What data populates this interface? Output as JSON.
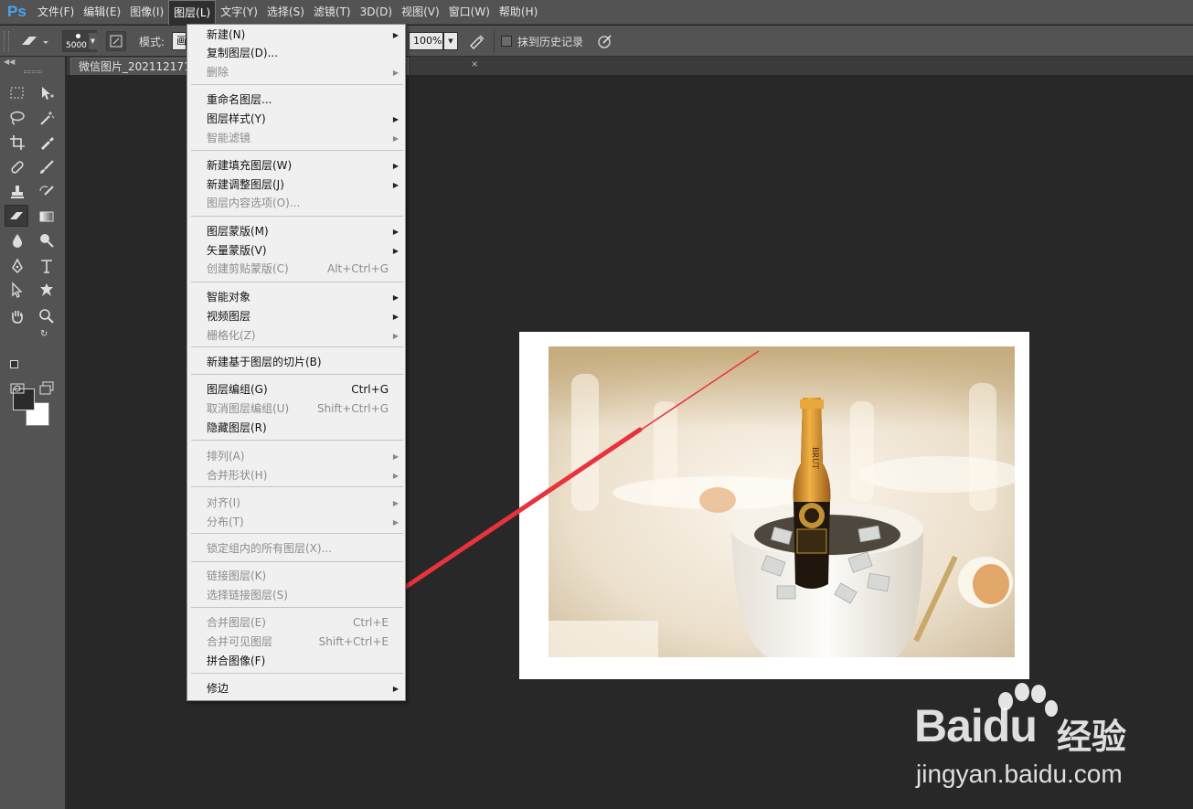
{
  "app": {
    "logo": "Ps"
  },
  "menubar": [
    {
      "label": "文件(F)"
    },
    {
      "label": "编辑(E)"
    },
    {
      "label": "图像(I)"
    },
    {
      "label": "图层(L)",
      "active": true
    },
    {
      "label": "文字(Y)"
    },
    {
      "label": "选择(S)"
    },
    {
      "label": "滤镜(T)"
    },
    {
      "label": "3D(D)"
    },
    {
      "label": "视图(V)"
    },
    {
      "label": "窗口(W)"
    },
    {
      "label": "帮助(H)"
    }
  ],
  "options": {
    "brush_size": "5000",
    "mode_label": "模式:",
    "mode_value": "画",
    "flow_value": "100%",
    "history_label": "抹到历史记录"
  },
  "tab": {
    "title": "微信图片_202112171"
  },
  "layer_menu": {
    "items": [
      {
        "label": "新建(N)",
        "shortcut": "",
        "submenu": true,
        "enabled": true
      },
      {
        "label": "复制图层(D)...",
        "shortcut": "",
        "submenu": false,
        "enabled": true
      },
      {
        "label": "删除",
        "shortcut": "",
        "submenu": true,
        "enabled": false
      },
      {
        "label": "重命名图层...",
        "shortcut": "",
        "submenu": false,
        "enabled": true
      },
      {
        "label": "图层样式(Y)",
        "shortcut": "",
        "submenu": true,
        "enabled": true
      },
      {
        "label": "智能滤镜",
        "shortcut": "",
        "submenu": true,
        "enabled": false
      },
      {
        "label": "新建填充图层(W)",
        "shortcut": "",
        "submenu": true,
        "enabled": true
      },
      {
        "label": "新建调整图层(J)",
        "shortcut": "",
        "submenu": true,
        "enabled": true
      },
      {
        "label": "图层内容选项(O)...",
        "shortcut": "",
        "submenu": false,
        "enabled": false
      },
      {
        "label": "图层蒙版(M)",
        "shortcut": "",
        "submenu": true,
        "enabled": true
      },
      {
        "label": "矢量蒙版(V)",
        "shortcut": "",
        "submenu": true,
        "enabled": true
      },
      {
        "label": "创建剪贴蒙版(C)",
        "shortcut": "Alt+Ctrl+G",
        "submenu": false,
        "enabled": false
      },
      {
        "label": "智能对象",
        "shortcut": "",
        "submenu": true,
        "enabled": true
      },
      {
        "label": "视频图层",
        "shortcut": "",
        "submenu": true,
        "enabled": true
      },
      {
        "label": "栅格化(Z)",
        "shortcut": "",
        "submenu": true,
        "enabled": false
      },
      {
        "label": "新建基于图层的切片(B)",
        "shortcut": "",
        "submenu": false,
        "enabled": true
      },
      {
        "label": "图层编组(G)",
        "shortcut": "Ctrl+G",
        "submenu": false,
        "enabled": true
      },
      {
        "label": "取消图层编组(U)",
        "shortcut": "Shift+Ctrl+G",
        "submenu": false,
        "enabled": false
      },
      {
        "label": "隐藏图层(R)",
        "shortcut": "",
        "submenu": false,
        "enabled": true
      },
      {
        "label": "排列(A)",
        "shortcut": "",
        "submenu": true,
        "enabled": false
      },
      {
        "label": "合并形状(H)",
        "shortcut": "",
        "submenu": true,
        "enabled": false
      },
      {
        "label": "对齐(I)",
        "shortcut": "",
        "submenu": true,
        "enabled": false
      },
      {
        "label": "分布(T)",
        "shortcut": "",
        "submenu": true,
        "enabled": false
      },
      {
        "label": "锁定组内的所有图层(X)...",
        "shortcut": "",
        "submenu": false,
        "enabled": false
      },
      {
        "label": "链接图层(K)",
        "shortcut": "",
        "submenu": false,
        "enabled": false
      },
      {
        "label": "选择链接图层(S)",
        "shortcut": "",
        "submenu": false,
        "enabled": false
      },
      {
        "label": "合并图层(E)",
        "shortcut": "Ctrl+E",
        "submenu": false,
        "enabled": false
      },
      {
        "label": "合并可见图层",
        "shortcut": "Shift+Ctrl+E",
        "submenu": false,
        "enabled": false
      },
      {
        "label": "拼合图像(F)",
        "shortcut": "",
        "submenu": false,
        "enabled": true
      },
      {
        "label": "修边",
        "shortcut": "",
        "submenu": true,
        "enabled": true
      }
    ]
  },
  "photo": {
    "bottle_label": "BRUT"
  },
  "watermark": {
    "brand": "Baidu",
    "suffix": "经验",
    "url": "jingyan.baidu.com"
  },
  "colors": {
    "annotation_arrow": "#e8323c",
    "menu_bg": "#f0f0f0",
    "ui_panel": "#535353"
  }
}
